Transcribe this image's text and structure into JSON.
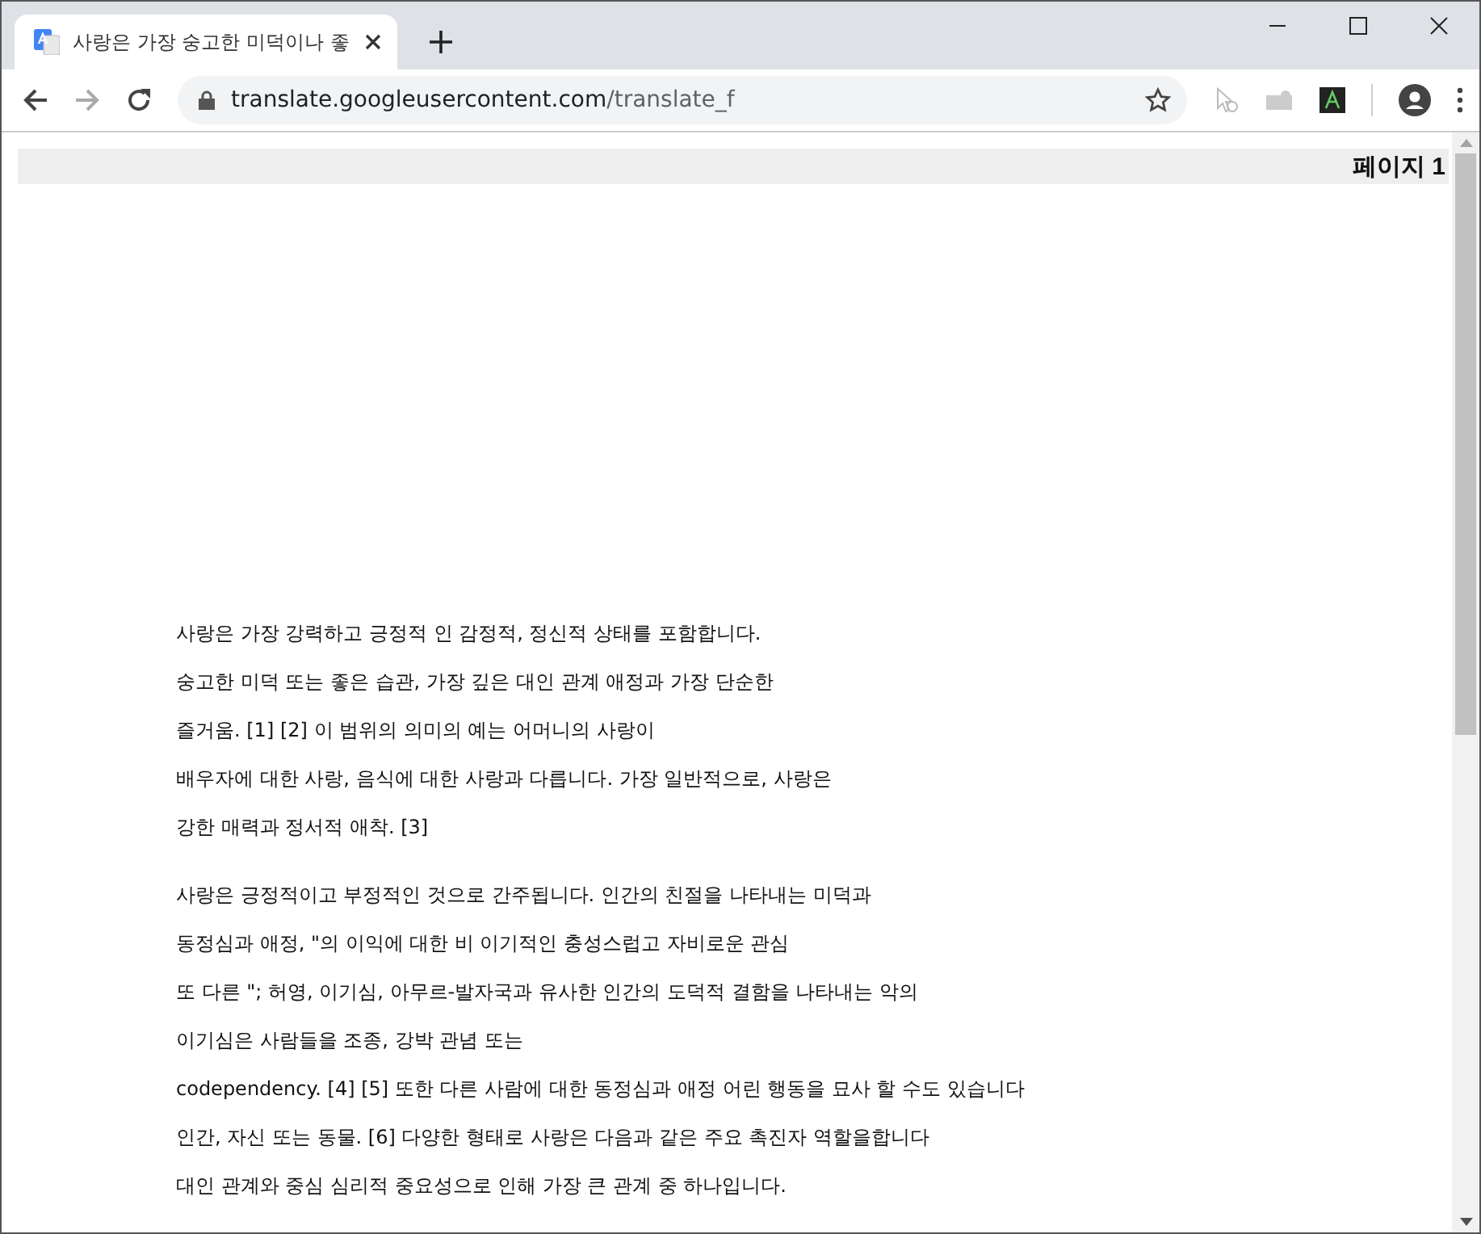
{
  "tab": {
    "title": "사랑은 가장 숭고한 미덕이나 좋",
    "selected": true
  },
  "address_bar": {
    "host": "translate.googleusercontent.com",
    "path": "/translate_f"
  },
  "page": {
    "header": "페이지 1",
    "paragraphs": [
      {
        "lines": [
          "사랑은 가장 강력하고 긍정적 인 감정적, 정신적 상태를 포함합니다.",
          "숭고한 미덕 또는 좋은 습관, 가장 깊은 대인 관계 애정과 가장 단순한",
          "즐거움. [1] [2] 이 범위의 의미의 예는 어머니의 사랑이",
          "배우자에 대한 사랑, 음식에 대한 사랑과 다릅니다. 가장 일반적으로, 사랑은",
          "강한 매력과 정서적 애착. [3]"
        ]
      },
      {
        "lines": [
          "사랑은 긍정적이고 부정적인 것으로 간주됩니다. 인간의 친절을 나타내는 미덕과",
          "동정심과 애정, \"의 이익에 대한 비 이기적인 충성스럽고 자비로운 관심",
          "또 다른 \"; 허영, 이기심, 아무르-발자국과 유사한 인간의 도덕적 결함을 나타내는 악의",
          "이기심은 사람들을 조종, 강박 관념 또는",
          "codependency. [4] [5] 또한 다른 사람에 대한 동정심과 애정 어린 행동을 묘사 할 수도 있습니다",
          "인간, 자신 또는 동물. [6] 다양한 형태로 사랑은 다음과 같은 주요 촉진자 역할을합니다",
          "대인 관계와 중심 심리적 중요성으로 인해 가장 큰 관계 중 하나입니다."
        ]
      }
    ]
  }
}
